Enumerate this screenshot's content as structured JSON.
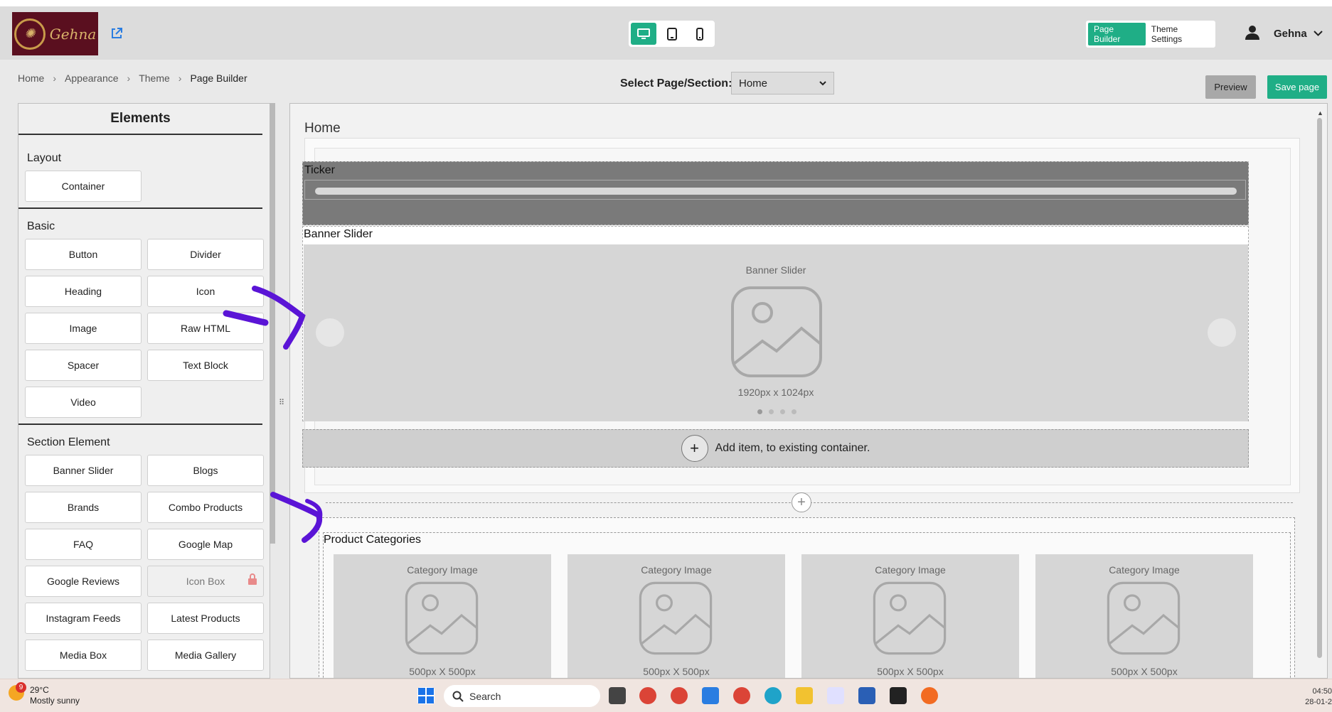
{
  "header": {
    "logo_text": "Gehna",
    "device_modes": [
      "desktop-icon",
      "tablet-icon",
      "mobile-icon"
    ],
    "mode_tabs": [
      {
        "label": "Page Builder",
        "active": true
      },
      {
        "label": "Theme Settings",
        "active": false
      }
    ],
    "user_name": "Gehna",
    "accent_color": "#1fae86"
  },
  "breadcrumb": [
    "Home",
    "Appearance",
    "Theme",
    "Page Builder"
  ],
  "page_select": {
    "label": "Select Page/Section:",
    "value": "Home"
  },
  "actions": {
    "preview": "Preview",
    "save": "Save page"
  },
  "elements_panel": {
    "title": "Elements",
    "sections": [
      {
        "title": "Layout",
        "items": [
          "Container"
        ]
      },
      {
        "title": "Basic",
        "items": [
          "Button",
          "Divider",
          "Heading",
          "Icon",
          "Image",
          "Raw HTML",
          "Spacer",
          "Text Block",
          "Video"
        ]
      },
      {
        "title": "Section Element",
        "items": [
          "Banner Slider",
          "Blogs",
          "Brands",
          "Combo Products",
          "FAQ",
          "Google Map",
          "Google Reviews",
          "Icon Box",
          "Instagram Feeds",
          "Latest Products",
          "Media Box",
          "Media Gallery"
        ]
      }
    ],
    "locked_items": [
      "Icon Box"
    ]
  },
  "canvas": {
    "title": "Home",
    "ticker_label": "Ticker",
    "banner": {
      "label": "Banner Slider",
      "caption": "Banner Slider",
      "size": "1920px x 1024px"
    },
    "add_item": "Add item, to existing container.",
    "product_categories": {
      "label": "Product Categories",
      "items": [
        {
          "caption": "Category Image",
          "size": "500px X 500px"
        },
        {
          "caption": "Category Image",
          "size": "500px X 500px"
        },
        {
          "caption": "Category Image",
          "size": "500px X 500px"
        },
        {
          "caption": "Category Image",
          "size": "500px X 500px"
        }
      ]
    }
  },
  "taskbar": {
    "weather_temp": "29°C",
    "weather_desc": "Mostly sunny",
    "weather_badge": "9",
    "search_placeholder": "Search",
    "time": "04:50",
    "date": "28-01-2"
  }
}
